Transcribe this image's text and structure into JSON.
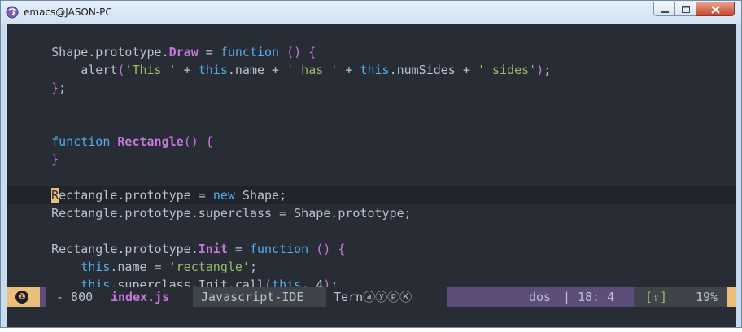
{
  "window": {
    "title": "emacs@JASON-PC",
    "icon": "emacs-icon",
    "buttons": [
      "minimize",
      "maximize",
      "close"
    ]
  },
  "editor": {
    "colors": {
      "background": "#282c34",
      "keyword": "#51afef",
      "function": "#c678dd",
      "string": "#98be65",
      "text": "#bbc2cf",
      "cursor": "#ecbe7b"
    },
    "lines": [
      {
        "indent": "",
        "tokens": []
      },
      {
        "indent": "    ",
        "tokens": [
          {
            "t": "plain",
            "v": "Shape.prototype."
          },
          {
            "t": "fn",
            "v": "Draw"
          },
          {
            "t": "plain",
            "v": " = "
          },
          {
            "t": "kw",
            "v": "function"
          },
          {
            "t": "plain",
            "v": " "
          },
          {
            "t": "paren",
            "v": "()"
          },
          {
            "t": "plain",
            "v": " "
          },
          {
            "t": "paren",
            "v": "{"
          }
        ]
      },
      {
        "indent": "        ",
        "tokens": [
          {
            "t": "plain",
            "v": "alert"
          },
          {
            "t": "paren",
            "v": "("
          },
          {
            "t": "str",
            "v": "'This '"
          },
          {
            "t": "plain",
            "v": " + "
          },
          {
            "t": "kw",
            "v": "this"
          },
          {
            "t": "plain",
            "v": ".name + "
          },
          {
            "t": "str",
            "v": "' has '"
          },
          {
            "t": "plain",
            "v": " + "
          },
          {
            "t": "kw",
            "v": "this"
          },
          {
            "t": "plain",
            "v": ".numSides + "
          },
          {
            "t": "str",
            "v": "' sides'"
          },
          {
            "t": "paren",
            "v": ")"
          },
          {
            "t": "plain",
            "v": ";"
          }
        ]
      },
      {
        "indent": "    ",
        "tokens": [
          {
            "t": "paren",
            "v": "}"
          },
          {
            "t": "plain",
            "v": ";"
          }
        ]
      },
      {
        "indent": "",
        "tokens": []
      },
      {
        "indent": "",
        "tokens": []
      },
      {
        "indent": "    ",
        "tokens": [
          {
            "t": "kw",
            "v": "function"
          },
          {
            "t": "plain",
            "v": " "
          },
          {
            "t": "fn",
            "v": "Rectangle"
          },
          {
            "t": "paren",
            "v": "()"
          },
          {
            "t": "plain",
            "v": " "
          },
          {
            "t": "paren",
            "v": "{"
          }
        ]
      },
      {
        "indent": "    ",
        "tokens": [
          {
            "t": "paren",
            "v": "}"
          }
        ]
      },
      {
        "indent": "",
        "tokens": []
      },
      {
        "indent": "    ",
        "current": true,
        "tokens": [
          {
            "t": "cursor",
            "v": "R"
          },
          {
            "t": "plain",
            "v": "ectangle.prototype = "
          },
          {
            "t": "kw",
            "v": "new"
          },
          {
            "t": "plain",
            "v": " Shape;"
          }
        ]
      },
      {
        "indent": "    ",
        "tokens": [
          {
            "t": "plain",
            "v": "Rectangle.prototype.superclass = Shape.prototype;"
          }
        ]
      },
      {
        "indent": "",
        "tokens": []
      },
      {
        "indent": "    ",
        "tokens": [
          {
            "t": "plain",
            "v": "Rectangle.prototype."
          },
          {
            "t": "fn",
            "v": "Init"
          },
          {
            "t": "plain",
            "v": " = "
          },
          {
            "t": "kw",
            "v": "function"
          },
          {
            "t": "plain",
            "v": " "
          },
          {
            "t": "paren",
            "v": "()"
          },
          {
            "t": "plain",
            "v": " "
          },
          {
            "t": "paren",
            "v": "{"
          }
        ]
      },
      {
        "indent": "        ",
        "tokens": [
          {
            "t": "kw",
            "v": "this"
          },
          {
            "t": "plain",
            "v": ".name = "
          },
          {
            "t": "str",
            "v": "'rectangle'"
          },
          {
            "t": "plain",
            "v": ";"
          }
        ]
      },
      {
        "indent": "        ",
        "tokens": [
          {
            "t": "kw",
            "v": "this"
          },
          {
            "t": "plain",
            "v": ".superclass.Init.call"
          },
          {
            "t": "paren",
            "v": "("
          },
          {
            "t": "kw",
            "v": "this"
          },
          {
            "t": "plain",
            "v": ", 4"
          },
          {
            "t": "paren",
            "v": ")"
          },
          {
            "t": "plain",
            "v": ";"
          }
        ]
      }
    ]
  },
  "modeline": {
    "warning_icon": "❶",
    "file": {
      "line_count": "- 800",
      "name": "index.js"
    },
    "major_mode": "Javascript-IDE",
    "minor_modes": "TernⓐⓨⓟⓀ",
    "encoding": "dos",
    "separator": "|",
    "position": "18: 4",
    "git": "[⇪]",
    "percent": "19%"
  }
}
